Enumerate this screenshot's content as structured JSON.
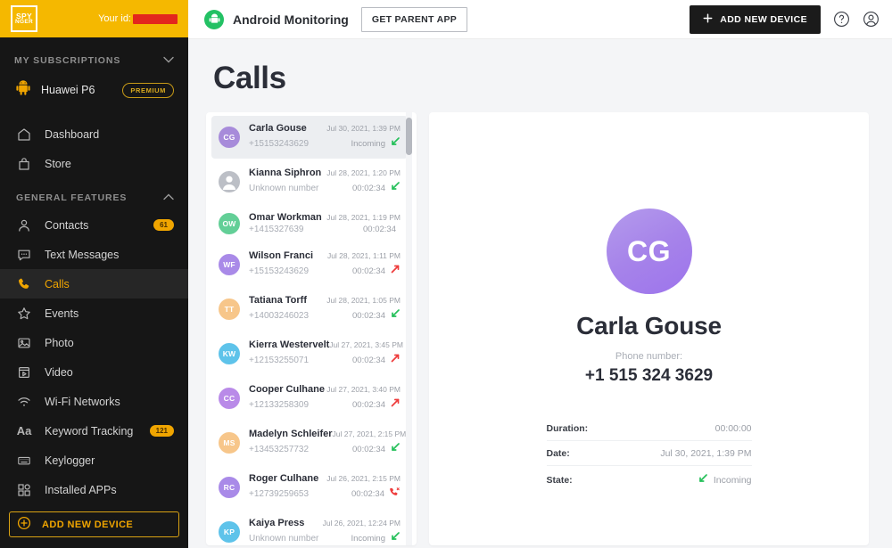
{
  "brand": {
    "logo_line1": "SPY",
    "logo_line2": "NGER",
    "your_id_label": "Your id:",
    "your_id_value": ""
  },
  "sidebar": {
    "subscriptions_label": "MY SUBSCRIPTIONS",
    "device": {
      "name": "Huawei P6",
      "plan_badge": "PREMIUM",
      "icon": "android-icon"
    },
    "top_items": [
      {
        "label": "Dashboard",
        "icon": "home-icon"
      },
      {
        "label": "Store",
        "icon": "bag-icon"
      }
    ],
    "general_features_label": "GENERAL FEATURES",
    "feature_items": [
      {
        "label": "Contacts",
        "icon": "person-icon",
        "badge": "61"
      },
      {
        "label": "Text Messages",
        "icon": "message-icon",
        "badge": ""
      },
      {
        "label": "Calls",
        "icon": "phone-icon",
        "badge": "",
        "active": true
      },
      {
        "label": "Events",
        "icon": "star-icon",
        "badge": ""
      },
      {
        "label": "Photo",
        "icon": "image-icon",
        "badge": ""
      },
      {
        "label": "Video",
        "icon": "video-icon",
        "badge": ""
      },
      {
        "label": "Wi-Fi Networks",
        "icon": "wifi-icon",
        "badge": ""
      },
      {
        "label": "Keyword Tracking",
        "icon": "text-aa-icon",
        "badge": "121"
      },
      {
        "label": "Keylogger",
        "icon": "keyboard-icon",
        "badge": ""
      },
      {
        "label": "Installed APPs",
        "icon": "apps-icon",
        "badge": ""
      }
    ],
    "add_device_label": "ADD NEW DEVICE"
  },
  "topbar": {
    "platform_title": "Android Monitoring",
    "platform_icon": "android-icon",
    "get_parent_app": "GET PARENT APP",
    "add_new_device": "ADD NEW DEVICE",
    "help_icon": "help-circle-icon",
    "account_icon": "account-circle-icon"
  },
  "page": {
    "title": "Calls"
  },
  "calls": [
    {
      "name": "Carla Gouse",
      "number": "+15153243629",
      "date": "Jul 30, 2021, 1:39 PM",
      "duration": "Incoming",
      "type": "incoming",
      "initials": "CG",
      "color": "#a78bda",
      "selected": true
    },
    {
      "name": "Kianna Siphron",
      "number": "Unknown number",
      "date": "Jul 28, 2021, 1:20 PM",
      "duration": "00:02:34",
      "type": "incoming",
      "initials": "",
      "color": "#bcbfc6",
      "selected": false
    },
    {
      "name": "Omar Workman",
      "number": "+1415327639",
      "date": "Jul 28, 2021, 1:19 PM",
      "duration": "00:02:34",
      "type": "rejected",
      "initials": "OW",
      "color": "#63cf97",
      "selected": false
    },
    {
      "name": "Wilson Franci",
      "number": "+15153243629",
      "date": "Jul 28, 2021, 1:11 PM",
      "duration": "00:02:34",
      "type": "outgoing",
      "initials": "WF",
      "color": "#a98ae8",
      "selected": false
    },
    {
      "name": "Tatiana Torff",
      "number": "+14003246023",
      "date": "Jul 28, 2021, 1:05 PM",
      "duration": "00:02:34",
      "type": "incoming",
      "initials": "TT",
      "color": "#f7c68a",
      "selected": false
    },
    {
      "name": "Kierra Westervelt",
      "number": "+12153255071",
      "date": "Jul 27, 2021, 3:45 PM",
      "duration": "00:02:34",
      "type": "outgoing",
      "initials": "KW",
      "color": "#5ec3ea",
      "selected": false
    },
    {
      "name": "Cooper Culhane",
      "number": "+12133258309",
      "date": "Jul 27, 2021, 3:40 PM",
      "duration": "00:02:34",
      "type": "outgoing",
      "initials": "CC",
      "color": "#b98ae8",
      "selected": false
    },
    {
      "name": "Madelyn Schleifer",
      "number": "+13453257732",
      "date": "Jul 27, 2021, 2:15 PM",
      "duration": "00:02:34",
      "type": "incoming",
      "initials": "MS",
      "color": "#f7c68a",
      "selected": false
    },
    {
      "name": "Roger Culhane",
      "number": "+12739259653",
      "date": "Jul 26, 2021, 2:15 PM",
      "duration": "00:02:34",
      "type": "missed",
      "initials": "RC",
      "color": "#a98ae8",
      "selected": false
    },
    {
      "name": "Kaiya Press",
      "number": "Unknown number",
      "date": "Jul 26, 2021, 12:24 PM",
      "duration": "Incoming",
      "type": "incoming",
      "initials": "KP",
      "color": "#5ec3ea",
      "selected": false
    }
  ],
  "detail": {
    "initials": "CG",
    "name": "Carla Gouse",
    "phone_label": "Phone number:",
    "phone": "+1 515 324 3629",
    "rows": [
      {
        "label": "Duration:",
        "value": "00:00:00",
        "icon": ""
      },
      {
        "label": "Date:",
        "value": "Jul 30, 2021, 1:39 PM",
        "icon": ""
      },
      {
        "label": "State:",
        "value": "Incoming",
        "icon": "incoming-arrow-icon"
      }
    ]
  },
  "colors": {
    "brand_yellow": "#f5b800",
    "accent_amber": "#f0a500",
    "incoming_green": "#25c05a",
    "outgoing_red": "#ee3b3b",
    "sidebar_bg": "#161616"
  }
}
